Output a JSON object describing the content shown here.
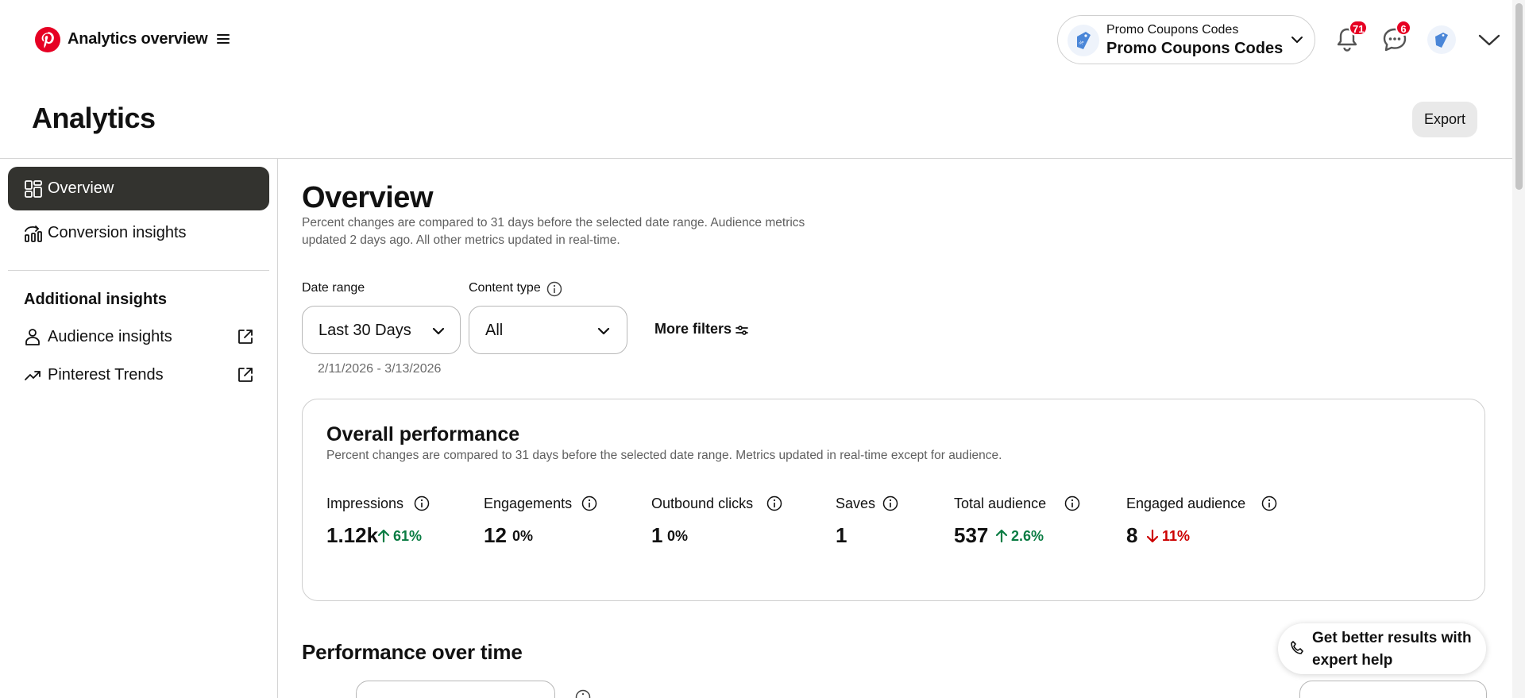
{
  "header": {
    "title": "Analytics overview",
    "account": {
      "line1": "Promo Coupons Codes",
      "line2": "Promo Coupons Codes"
    },
    "notifications_count": "71",
    "messages_count": "6"
  },
  "page": {
    "title": "Analytics",
    "export_label": "Export"
  },
  "sidebar": {
    "items": [
      {
        "label": "Overview",
        "icon": "grid-icon",
        "active": true
      },
      {
        "label": "Conversion insights",
        "icon": "conversion-icon",
        "active": false
      }
    ],
    "additional_heading": "Additional insights",
    "additional_items": [
      {
        "label": "Audience insights",
        "icon": "person-icon"
      },
      {
        "label": "Pinterest Trends",
        "icon": "trend-icon"
      }
    ]
  },
  "overview": {
    "title": "Overview",
    "description": "Percent changes are compared to 31 days before the selected date range. Audience metrics updated 2 days ago. All other metrics updated in real-time."
  },
  "filters": {
    "date_range_label": "Date range",
    "date_range_value": "Last 30 Days",
    "date_range_hint": "2/11/2026 - 3/13/2026",
    "content_type_label": "Content type",
    "content_type_value": "All",
    "more_filters_label": "More filters"
  },
  "performance": {
    "title": "Overall performance",
    "description": "Percent changes are compared to 31 days before the selected date range. Metrics updated in real-time except for audience.",
    "metrics": [
      {
        "label": "Impressions",
        "value": "1.12k",
        "change": "61%",
        "direction": "up"
      },
      {
        "label": "Engagements",
        "value": "12",
        "change": "0%",
        "direction": "flat"
      },
      {
        "label": "Outbound clicks",
        "value": "1",
        "change": "0%",
        "direction": "flat"
      },
      {
        "label": "Saves",
        "value": "1",
        "change": "",
        "direction": "none"
      },
      {
        "label": "Total audience",
        "value": "537",
        "change": "2.6%",
        "direction": "up"
      },
      {
        "label": "Engaged audience",
        "value": "8",
        "change": "11%",
        "direction": "down"
      }
    ]
  },
  "performance_over_time": {
    "title": "Performance over time"
  },
  "help": {
    "label": "Get better results with expert help"
  },
  "colors": {
    "brand": "#e60023",
    "up": "#0a7c43",
    "down": "#cc0000",
    "active_nav": "#33332f"
  }
}
